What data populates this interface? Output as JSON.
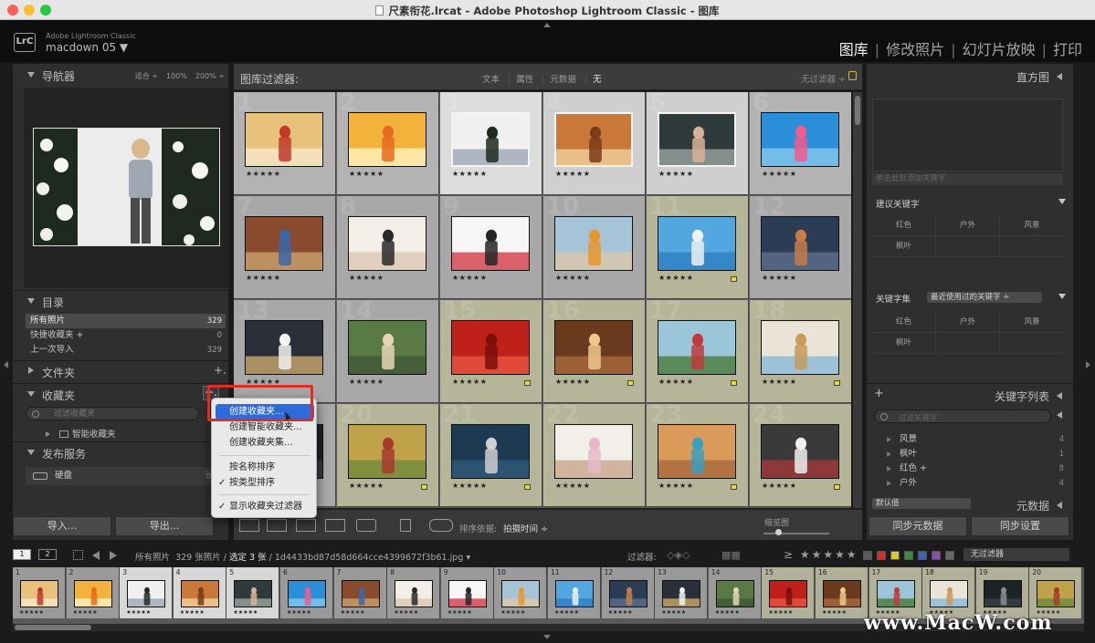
{
  "window": {
    "title": "尺素衔花.lrcat - Adobe Photoshop Lightroom Classic - 图库"
  },
  "identity": {
    "app_name": "Adobe Lightroom Classic",
    "user_name": "macdown 05 ▼",
    "logo_text": "LrC"
  },
  "modules": [
    "图库",
    "修改照片",
    "幻灯片放映",
    "打印"
  ],
  "navigator": {
    "title": "导航器",
    "options": [
      "适合 ÷",
      "100%",
      "200% ÷"
    ]
  },
  "catalog": {
    "title": "目录",
    "rows": [
      {
        "label": "所有照片",
        "count": "329"
      },
      {
        "label": "快捷收藏夹 +",
        "count": "0"
      },
      {
        "label": "上一次导入",
        "count": "329"
      }
    ]
  },
  "folders": {
    "title": "文件夹",
    "add": "+."
  },
  "collections": {
    "title": "收藏夹",
    "add": "+.",
    "search_placeholder": "过滤收藏夹",
    "smart_label": "智能收藏夹"
  },
  "publish": {
    "title": "发布服务",
    "drive_label": "硬盘",
    "drive_setup": "设置"
  },
  "left_buttons": {
    "import": "导入...",
    "export": "导出..."
  },
  "popup_menu": {
    "items": [
      {
        "label": "创建收藏夹...",
        "checked": false,
        "highlighted": true
      },
      {
        "label": "创建智能收藏夹...",
        "checked": false,
        "highlighted": false
      },
      {
        "label": "创建收藏夹集...",
        "checked": false,
        "highlighted": false
      },
      {
        "label": "按名称排序",
        "checked": false,
        "highlighted": false
      },
      {
        "label": "按类型排序",
        "checked": true,
        "highlighted": false
      },
      {
        "label": "显示收藏夹过滤器",
        "checked": true,
        "highlighted": false
      }
    ]
  },
  "filter_bar": {
    "title": "图库过滤器:",
    "tabs": [
      "文本",
      "属性",
      "元数据",
      "无"
    ],
    "active_tab": "无",
    "preset": "无过滤器 ÷"
  },
  "grid": {
    "stars": "★★★★★",
    "cells": [
      {
        "num": "1",
        "bg": "#b3b3b3",
        "thumb": "food1",
        "flag": false,
        "sel": false
      },
      {
        "num": "2",
        "bg": "#b3b3b3",
        "thumb": "food2",
        "flag": false,
        "sel": false
      },
      {
        "num": "3",
        "bg": "#dcdcdc",
        "thumb": "blue1",
        "flag": false,
        "sel": true
      },
      {
        "num": "4",
        "bg": "#cfcfcf",
        "thumb": "food3",
        "flag": false,
        "sel": true
      },
      {
        "num": "5",
        "bg": "#cfcfcf",
        "thumb": "girl1",
        "flag": false,
        "sel": true
      },
      {
        "num": "6",
        "bg": "#b3b3b3",
        "thumb": "sea1",
        "flag": false,
        "sel": false
      },
      {
        "num": "7",
        "bg": "#a8a8a8",
        "thumb": "brick",
        "flag": false,
        "sel": false
      },
      {
        "num": "8",
        "bg": "#a8a8a8",
        "thumb": "light1",
        "flag": false,
        "sel": false
      },
      {
        "num": "9",
        "bg": "#a8a8a8",
        "thumb": "white1",
        "flag": false,
        "sel": false
      },
      {
        "num": "10",
        "bg": "#a8a8a8",
        "thumb": "beach1",
        "flag": false,
        "sel": false
      },
      {
        "num": "11",
        "bg": "#b5b59a",
        "thumb": "sky1",
        "flag": true,
        "sel": false
      },
      {
        "num": "12",
        "bg": "#a8a8a8",
        "thumb": "dusk1",
        "flag": false,
        "sel": false
      },
      {
        "num": "13",
        "bg": "#a8a8a8",
        "thumb": "car1",
        "flag": false,
        "sel": false
      },
      {
        "num": "14",
        "bg": "#a8a8a8",
        "thumb": "group1",
        "flag": false,
        "sel": false
      },
      {
        "num": "15",
        "bg": "#b5b59a",
        "thumb": "red1",
        "flag": true,
        "sel": false
      },
      {
        "num": "16",
        "bg": "#b5b59a",
        "thumb": "warm1",
        "flag": true,
        "sel": false
      },
      {
        "num": "17",
        "bg": "#b5b59a",
        "thumb": "palm1",
        "flag": true,
        "sel": false
      },
      {
        "num": "18",
        "bg": "#b5b59a",
        "thumb": "hat1",
        "flag": true,
        "sel": false
      },
      {
        "num": "19",
        "bg": "#a8a8a8",
        "thumb": "dark1",
        "flag": false,
        "sel": false
      },
      {
        "num": "20",
        "bg": "#b5b59a",
        "thumb": "field1",
        "flag": true,
        "sel": false
      },
      {
        "num": "21",
        "bg": "#b5b59a",
        "thumb": "rock1",
        "flag": true,
        "sel": false
      },
      {
        "num": "22",
        "bg": "#b5b59a",
        "thumb": "kids1",
        "flag": false,
        "sel": false
      },
      {
        "num": "23",
        "bg": "#b5b59a",
        "thumb": "lake1",
        "flag": true,
        "sel": false
      },
      {
        "num": "24",
        "bg": "#b5b59a",
        "thumb": "car2",
        "flag": true,
        "sel": false
      }
    ]
  },
  "toolbar": {
    "sort_label": "排序依据:",
    "sort_value": "拍摄时间 ÷",
    "thumb_label": "缩览图"
  },
  "right_panel": {
    "histogram": "直方图",
    "keyword_placeholder": "单击此处添加关键字",
    "suggested": "建议关键字",
    "suggested_words": [
      "红色",
      "户外",
      "风景",
      "枫叶"
    ],
    "keyword_set": "关键字集",
    "keyword_set_value": "最近使用过的关键字 ÷",
    "set_words": [
      "红色",
      "户外",
      "风景",
      "枫叶"
    ],
    "keyword_list": "关键字列表",
    "keyword_list_add": "+",
    "kw_search_placeholder": "过滤关键字",
    "keywords": [
      {
        "label": "风景",
        "count": "4"
      },
      {
        "label": "枫叶",
        "count": "1"
      },
      {
        "label": "红色 +",
        "count": "8"
      },
      {
        "label": "户外",
        "count": "4"
      }
    ],
    "default_value": "默认值",
    "metadata": "元数据",
    "sync_metadata": "同步元数据",
    "sync_settings": "同步设置"
  },
  "filmstrip_bar": {
    "page1": "1",
    "page2": "2",
    "path_prefix": "所有照片",
    "path_count": "329 张照片 /",
    "path_selected": "选定 3 张",
    "path_file": "/ 1d4433bd87d58d664cce4399672f3b61.jpg ▾",
    "filter_label": "过滤器:",
    "stars": "≥ ★★★★★",
    "no_filter": "无过滤器"
  },
  "filmstrip": {
    "stars": "★★★★★",
    "items": [
      {
        "num": "1",
        "thumb": "food1"
      },
      {
        "num": "2",
        "thumb": "food2"
      },
      {
        "num": "3",
        "thumb": "blue1"
      },
      {
        "num": "4",
        "thumb": "food3"
      },
      {
        "num": "5",
        "thumb": "girl1"
      },
      {
        "num": "6",
        "thumb": "sea1"
      },
      {
        "num": "7",
        "thumb": "brick"
      },
      {
        "num": "8",
        "thumb": "light1"
      },
      {
        "num": "9",
        "thumb": "white1"
      },
      {
        "num": "10",
        "thumb": "beach1"
      },
      {
        "num": "11",
        "thumb": "sky1"
      },
      {
        "num": "12",
        "thumb": "dusk1"
      },
      {
        "num": "13",
        "thumb": "car1"
      },
      {
        "num": "14",
        "thumb": "group1"
      },
      {
        "num": "15",
        "thumb": "red1"
      },
      {
        "num": "16",
        "thumb": "warm1"
      },
      {
        "num": "17",
        "thumb": "palm1"
      },
      {
        "num": "18",
        "thumb": "hat1"
      },
      {
        "num": "19",
        "thumb": "dark1"
      },
      {
        "num": "20",
        "thumb": "field1"
      }
    ]
  },
  "watermark": "www.MacW.com"
}
